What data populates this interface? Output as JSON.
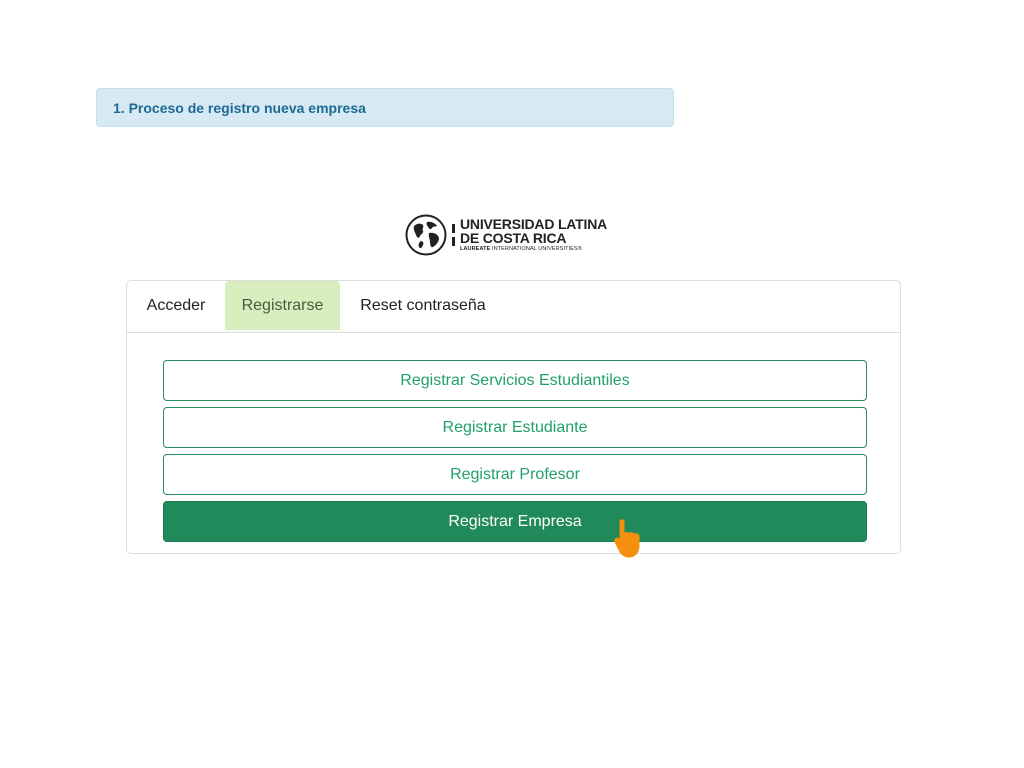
{
  "step_banner": {
    "text": "1. Proceso de registro nueva empresa",
    "background": "#d7eaf4",
    "color": "#1c6a93"
  },
  "logo": {
    "line1": "UNIVERSIDAD LATINA",
    "line2": "DE COSTA RICA",
    "line3_bold": "LAUREATE",
    "line3_rest": " INTERNATIONAL UNIVERSITIES®"
  },
  "tabs": [
    {
      "label": "Acceder",
      "active": false
    },
    {
      "label": "Registrarse",
      "active": true
    },
    {
      "label": "Reset contraseña",
      "active": false
    }
  ],
  "buttons": [
    {
      "label": "Registrar Servicios Estudiantiles",
      "style": "outline"
    },
    {
      "label": "Registrar Estudiante",
      "style": "outline"
    },
    {
      "label": "Registrar Profesor",
      "style": "outline"
    },
    {
      "label": "Registrar Empresa",
      "style": "filled"
    }
  ],
  "colors": {
    "accent_green": "#218a5a",
    "tab_active_bg": "#d9eebf",
    "cursor": "#f5900f"
  },
  "cursor_icon": "hand-pointer-icon"
}
